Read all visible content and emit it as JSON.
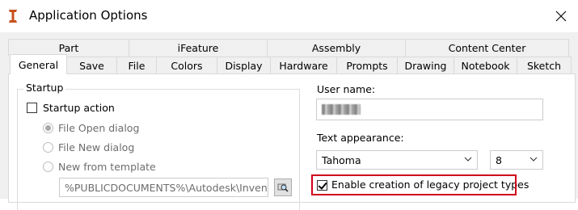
{
  "window": {
    "title": "Application Options",
    "close_label": "close"
  },
  "tabs": {
    "row1": [
      {
        "label": "Part"
      },
      {
        "label": "iFeature"
      },
      {
        "label": "Assembly"
      },
      {
        "label": "Content Center"
      }
    ],
    "row2": [
      {
        "label": "General",
        "selected": true
      },
      {
        "label": "Save"
      },
      {
        "label": "File"
      },
      {
        "label": "Colors"
      },
      {
        "label": "Display"
      },
      {
        "label": "Hardware"
      },
      {
        "label": "Prompts"
      },
      {
        "label": "Drawing"
      },
      {
        "label": "Notebook"
      },
      {
        "label": "Sketch"
      }
    ]
  },
  "startup": {
    "group_label": "Startup",
    "startup_action_label": "Startup action",
    "startup_action_checked": false,
    "options": [
      {
        "label": "File Open dialog",
        "selected": true
      },
      {
        "label": "File New dialog",
        "selected": false
      },
      {
        "label": "New from template",
        "selected": false
      }
    ],
    "template_path": "%PUBLICDOCUMENTS%\\Autodesk\\Inventor"
  },
  "user": {
    "user_name_label": "User name:",
    "text_appearance_label": "Text appearance:",
    "font_value": "Tahoma",
    "size_value": "8",
    "legacy_label": "Enable creation of legacy project types",
    "legacy_checked": true
  },
  "colors": {
    "highlight": "#d0021b",
    "app_icon": "#c8501e"
  }
}
